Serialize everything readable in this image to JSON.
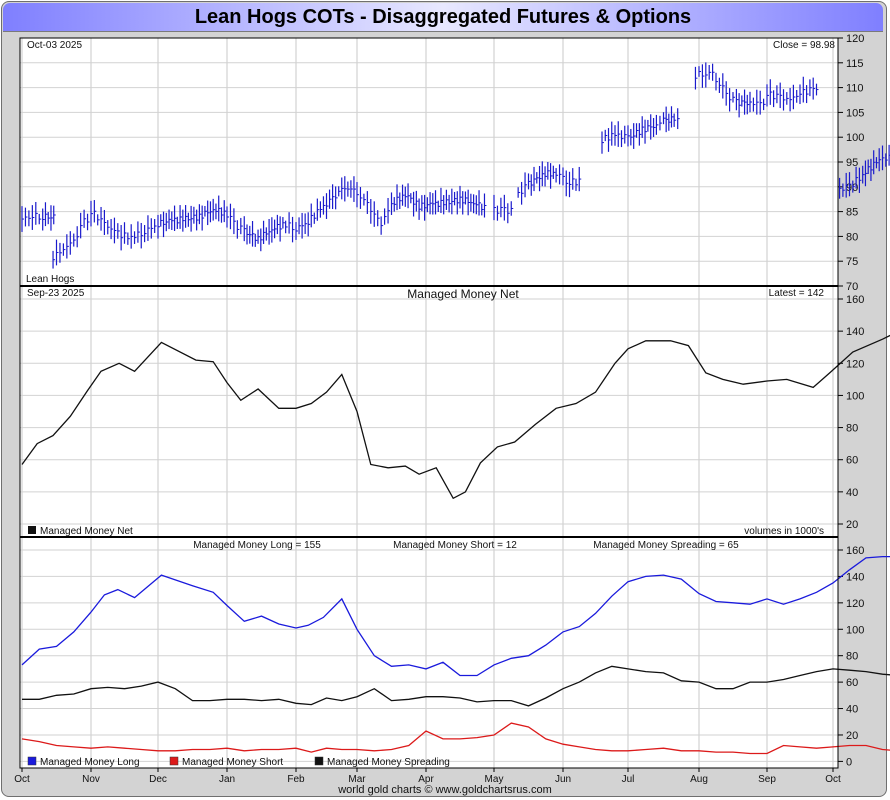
{
  "header": {
    "title": "Lean Hogs COTs - Disaggregated Futures & Options"
  },
  "footer": {
    "credit": "world gold charts © www.goldchartsrus.com"
  },
  "x_axis": {
    "months": [
      "Oct",
      "Nov",
      "Dec",
      "Jan",
      "Feb",
      "Mar",
      "Apr",
      "May",
      "Jun",
      "Jul",
      "Aug",
      "Sep",
      "Oct"
    ]
  },
  "chart_data": [
    {
      "type": "bar",
      "subtype": "ohlc-price",
      "date_label": "Oct-03  2025",
      "latest_label": "Close = 98.98",
      "series_label": "Lean Hogs",
      "color": "#1a1acc",
      "ylim": [
        70,
        120
      ],
      "yticks": [
        70,
        75,
        80,
        85,
        90,
        95,
        100,
        105,
        110,
        115,
        120
      ],
      "x_range": [
        0,
        12
      ],
      "segments": [
        [
          [
            0.0,
            83.5
          ],
          [
            0.15,
            84.2
          ],
          [
            0.3,
            84.0
          ],
          [
            0.5,
            83.8
          ]
        ],
        [
          [
            0.45,
            75.8
          ],
          [
            0.6,
            77.5
          ],
          [
            0.75,
            79.0
          ],
          [
            0.9,
            83.0
          ],
          [
            1.05,
            84.5
          ],
          [
            1.2,
            82.5
          ],
          [
            1.4,
            80.5
          ],
          [
            1.6,
            79.8
          ],
          [
            1.8,
            81.0
          ],
          [
            2.0,
            82.5
          ],
          [
            2.2,
            83.2
          ],
          [
            2.4,
            83.5
          ],
          [
            2.6,
            84.0
          ],
          [
            2.8,
            85.5
          ],
          [
            3.0,
            84.5
          ],
          [
            3.1,
            82.5
          ],
          [
            3.25,
            81.0
          ],
          [
            3.45,
            79.5
          ],
          [
            3.65,
            81.5
          ],
          [
            3.85,
            82.5
          ],
          [
            4.0,
            81.5
          ],
          [
            4.2,
            83.0
          ],
          [
            4.4,
            85.5
          ],
          [
            4.6,
            87.5
          ],
          [
            4.75,
            89.5
          ],
          [
            4.9,
            89.8
          ],
          [
            5.0,
            88.5
          ],
          [
            5.15,
            86.5
          ],
          [
            5.25,
            84.5
          ],
          [
            5.35,
            82.5
          ],
          [
            5.5,
            86.5
          ],
          [
            5.7,
            88.5
          ],
          [
            5.9,
            86.0
          ],
          [
            6.1,
            86.5
          ],
          [
            6.3,
            86.8
          ],
          [
            6.5,
            87.5
          ],
          [
            6.7,
            86.8
          ],
          [
            6.9,
            85.5
          ]
        ],
        [
          [
            7.0,
            85.3
          ],
          [
            7.15,
            85.2
          ],
          [
            7.3,
            85.2
          ]
        ],
        [
          [
            7.35,
            88.5
          ],
          [
            7.5,
            90.5
          ],
          [
            7.7,
            92.5
          ],
          [
            7.9,
            92.8
          ],
          [
            8.0,
            91.5
          ],
          [
            8.1,
            91.0
          ],
          [
            8.3,
            91.0
          ]
        ],
        [
          [
            8.6,
            99.5
          ],
          [
            8.8,
            100.5
          ],
          [
            9.0,
            99.8
          ],
          [
            9.2,
            101.5
          ],
          [
            9.4,
            102.5
          ],
          [
            9.5,
            103.5
          ],
          [
            9.65,
            103.5
          ],
          [
            9.75,
            103.5
          ]
        ],
        [
          [
            9.95,
            112.5
          ],
          [
            10.1,
            113.0
          ],
          [
            10.2,
            112.5
          ],
          [
            10.3,
            111.0
          ],
          [
            10.4,
            108.5
          ],
          [
            10.55,
            107.0
          ],
          [
            10.75,
            107.0
          ],
          [
            10.9,
            106.5
          ],
          [
            11.05,
            108.5
          ],
          [
            11.2,
            108.0
          ],
          [
            11.35,
            107.5
          ],
          [
            11.5,
            109.0
          ],
          [
            11.7,
            109.5
          ],
          [
            11.8,
            110.0
          ]
        ],
        [
          [
            12.1,
            89.5
          ],
          [
            12.25,
            90.0
          ],
          [
            12.45,
            92.5
          ],
          [
            12.7,
            95.5
          ],
          [
            12.9,
            96.0
          ],
          [
            13.1,
            97.5
          ],
          [
            13.3,
            97.5
          ],
          [
            13.5,
            99.5
          ],
          [
            13.65,
            101.5
          ],
          [
            13.75,
            101.0
          ],
          [
            13.85,
            99.0
          ]
        ]
      ]
    },
    {
      "type": "line",
      "title": "Managed Money Net",
      "date_label": "Sep-23  2025",
      "latest_label": "Latest = 142",
      "units_label": "volumes in 1000's",
      "ylim": [
        20,
        160
      ],
      "yticks": [
        20,
        40,
        60,
        80,
        100,
        120,
        140,
        160
      ],
      "x_range": [
        0,
        12
      ],
      "legend": [
        {
          "label": "Managed Money Net",
          "color": "#111111"
        }
      ],
      "series": [
        {
          "name": "Managed Money Net",
          "color": "#111111",
          "x": [
            0.0,
            0.22,
            0.45,
            0.7,
            0.95,
            1.15,
            1.42,
            1.65,
            2.05,
            2.55,
            2.8,
            3.0,
            3.2,
            3.45,
            3.75,
            4.0,
            4.25,
            4.5,
            4.75,
            5.0,
            5.2,
            5.45,
            5.7,
            5.9,
            6.15,
            6.4,
            6.58,
            6.8,
            7.05,
            7.3,
            7.6,
            7.9,
            8.2,
            8.5,
            8.8,
            9.0,
            9.25,
            9.6,
            9.85,
            10.1,
            10.35,
            10.65,
            11.0,
            11.3,
            11.7,
            11.95,
            12.3,
            12.75,
            13.1,
            13.4,
            13.7
          ],
          "values": [
            57,
            70,
            75,
            87,
            103,
            115,
            120,
            115,
            133,
            122,
            121,
            108,
            97,
            104,
            92,
            92,
            95,
            102,
            113,
            90,
            57,
            55,
            56,
            51,
            55,
            36,
            40,
            58,
            68,
            71,
            82,
            92,
            95,
            102,
            120,
            129,
            134,
            134,
            131,
            114,
            110,
            107,
            109,
            110,
            105,
            114,
            127,
            135,
            142,
            142,
            142
          ]
        }
      ]
    },
    {
      "type": "line",
      "ylim": [
        -5,
        160
      ],
      "yticks": [
        0,
        20,
        40,
        60,
        80,
        100,
        120,
        140,
        160
      ],
      "x_range": [
        0,
        12
      ],
      "header_labels": [
        "Managed Money Long = 155",
        "Managed Money Short = 12",
        "Managed Money Spreading = 65"
      ],
      "legend": [
        {
          "label": "Managed Money Long",
          "color": "#1a1adc"
        },
        {
          "label": "Managed Money Short",
          "color": "#dc1a1a"
        },
        {
          "label": "Managed Money Spreading",
          "color": "#111111"
        }
      ],
      "series": [
        {
          "name": "Managed Money Long",
          "color": "#1a1adc",
          "x": [
            0.0,
            0.25,
            0.5,
            0.75,
            1.0,
            1.2,
            1.4,
            1.65,
            2.05,
            2.5,
            2.8,
            3.0,
            3.25,
            3.5,
            3.75,
            4.0,
            4.2,
            4.45,
            4.75,
            5.0,
            5.25,
            5.5,
            5.75,
            6.0,
            6.25,
            6.5,
            6.75,
            7.0,
            7.25,
            7.5,
            7.75,
            8.0,
            8.25,
            8.5,
            8.75,
            9.0,
            9.25,
            9.5,
            9.75,
            10.0,
            10.25,
            10.5,
            10.75,
            11.0,
            11.25,
            11.5,
            11.75,
            12.0,
            12.25,
            12.5,
            12.75,
            13.0,
            13.25,
            13.5,
            13.7
          ],
          "values": [
            73,
            85,
            87,
            98,
            113,
            126,
            130,
            124,
            141,
            133,
            128,
            118,
            106,
            110,
            104,
            101,
            103,
            109,
            123,
            100,
            80,
            72,
            73,
            70,
            75,
            65,
            65,
            73,
            78,
            80,
            88,
            98,
            102,
            112,
            125,
            136,
            140,
            141,
            138,
            127,
            121,
            120,
            119,
            123,
            119,
            123,
            128,
            135,
            145,
            154,
            155,
            155,
            155,
            155,
            155
          ]
        },
        {
          "name": "Managed Money Short",
          "color": "#dc1a1a",
          "x": [
            0.0,
            0.25,
            0.5,
            0.75,
            1.0,
            1.25,
            1.5,
            1.75,
            2.0,
            2.25,
            2.5,
            2.75,
            3.0,
            3.25,
            3.5,
            3.75,
            4.0,
            4.25,
            4.5,
            4.75,
            5.0,
            5.25,
            5.5,
            5.75,
            6.0,
            6.25,
            6.5,
            6.75,
            7.0,
            7.25,
            7.5,
            7.75,
            8.0,
            8.25,
            8.5,
            8.75,
            9.0,
            9.25,
            9.5,
            9.75,
            10.0,
            10.25,
            10.5,
            10.75,
            11.0,
            11.25,
            11.5,
            11.75,
            12.0,
            12.25,
            12.5,
            12.75,
            13.0,
            13.25,
            13.5,
            13.7
          ],
          "values": [
            17,
            15,
            12,
            11,
            10,
            11,
            10,
            9,
            8,
            8,
            9,
            9,
            10,
            8,
            9,
            9,
            10,
            7,
            10,
            9,
            9,
            8,
            9,
            12,
            23,
            17,
            17,
            18,
            20,
            29,
            26,
            17,
            13,
            11,
            9,
            8,
            8,
            9,
            10,
            8,
            8,
            7,
            7,
            6,
            6,
            12,
            11,
            10,
            11,
            12,
            12,
            9,
            8,
            8,
            11,
            12
          ]
        },
        {
          "name": "Managed Money Spreading",
          "color": "#111111",
          "x": [
            0.0,
            0.25,
            0.5,
            0.75,
            1.0,
            1.25,
            1.5,
            1.75,
            2.0,
            2.25,
            2.5,
            2.75,
            3.0,
            3.25,
            3.5,
            3.75,
            4.0,
            4.25,
            4.5,
            4.75,
            5.0,
            5.25,
            5.5,
            5.75,
            6.0,
            6.25,
            6.5,
            6.75,
            7.0,
            7.25,
            7.5,
            7.75,
            8.0,
            8.25,
            8.5,
            8.75,
            9.0,
            9.25,
            9.5,
            9.75,
            10.0,
            10.25,
            10.5,
            10.75,
            11.0,
            11.25,
            11.5,
            11.75,
            12.0,
            12.25,
            12.5,
            12.75,
            13.0,
            13.25,
            13.5,
            13.7
          ],
          "values": [
            47,
            47,
            50,
            51,
            55,
            56,
            55,
            57,
            60,
            55,
            46,
            46,
            47,
            47,
            46,
            47,
            44,
            43,
            48,
            46,
            49,
            55,
            46,
            47,
            49,
            49,
            48,
            45,
            46,
            46,
            42,
            48,
            55,
            60,
            67,
            72,
            70,
            68,
            67,
            61,
            60,
            55,
            55,
            60,
            60,
            62,
            65,
            68,
            70,
            69,
            68,
            66,
            65,
            65,
            65,
            65
          ]
        }
      ]
    }
  ]
}
